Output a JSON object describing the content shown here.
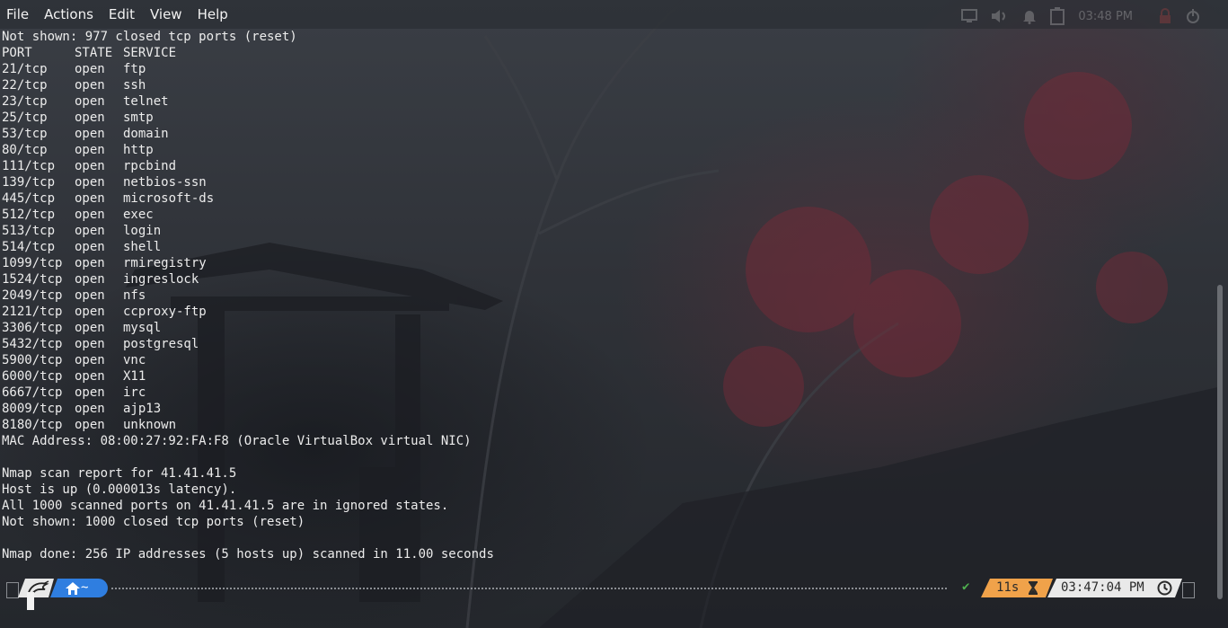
{
  "menubar": {
    "items": [
      "File",
      "Actions",
      "Edit",
      "View",
      "Help"
    ]
  },
  "panel": {
    "time": "03:48 PM",
    "icons": [
      "monitor-icon",
      "volume-icon",
      "bell-icon",
      "battery-icon",
      "lock-icon",
      "power-icon"
    ]
  },
  "terminal": {
    "not_shown_1": "Not shown: 977 closed tcp ports (reset)",
    "headers": {
      "port": "PORT",
      "state": "STATE",
      "service": "SERVICE"
    },
    "ports": [
      {
        "port": "21/tcp",
        "state": "open",
        "service": "ftp"
      },
      {
        "port": "22/tcp",
        "state": "open",
        "service": "ssh"
      },
      {
        "port": "23/tcp",
        "state": "open",
        "service": "telnet"
      },
      {
        "port": "25/tcp",
        "state": "open",
        "service": "smtp"
      },
      {
        "port": "53/tcp",
        "state": "open",
        "service": "domain"
      },
      {
        "port": "80/tcp",
        "state": "open",
        "service": "http"
      },
      {
        "port": "111/tcp",
        "state": "open",
        "service": "rpcbind"
      },
      {
        "port": "139/tcp",
        "state": "open",
        "service": "netbios-ssn"
      },
      {
        "port": "445/tcp",
        "state": "open",
        "service": "microsoft-ds"
      },
      {
        "port": "512/tcp",
        "state": "open",
        "service": "exec"
      },
      {
        "port": "513/tcp",
        "state": "open",
        "service": "login"
      },
      {
        "port": "514/tcp",
        "state": "open",
        "service": "shell"
      },
      {
        "port": "1099/tcp",
        "state": "open",
        "service": "rmiregistry"
      },
      {
        "port": "1524/tcp",
        "state": "open",
        "service": "ingreslock"
      },
      {
        "port": "2049/tcp",
        "state": "open",
        "service": "nfs"
      },
      {
        "port": "2121/tcp",
        "state": "open",
        "service": "ccproxy-ftp"
      },
      {
        "port": "3306/tcp",
        "state": "open",
        "service": "mysql"
      },
      {
        "port": "5432/tcp",
        "state": "open",
        "service": "postgresql"
      },
      {
        "port": "5900/tcp",
        "state": "open",
        "service": "vnc"
      },
      {
        "port": "6000/tcp",
        "state": "open",
        "service": "X11"
      },
      {
        "port": "6667/tcp",
        "state": "open",
        "service": "irc"
      },
      {
        "port": "8009/tcp",
        "state": "open",
        "service": "ajp13"
      },
      {
        "port": "8180/tcp",
        "state": "open",
        "service": "unknown"
      }
    ],
    "mac": "MAC Address: 08:00:27:92:FA:F8 (Oracle VirtualBox virtual NIC)",
    "report": "Nmap scan report for 41.41.41.5",
    "host_up": "Host is up (0.000013s latency).",
    "ignored": "All 1000 scanned ports on 41.41.41.5 are in ignored states.",
    "not_shown_2": "Not shown: 1000 closed tcp ports (reset)",
    "done": "Nmap done: 256 IP addresses (5 hosts up) scanned in 11.00 seconds"
  },
  "prompt": {
    "dir": "~",
    "duration": "11s",
    "time": "03:47:04 PM",
    "colors": {
      "home": "#2f7ee0",
      "duration": "#f0a24a",
      "time": "#e9e9e9",
      "ok": "#4fb04f"
    }
  }
}
